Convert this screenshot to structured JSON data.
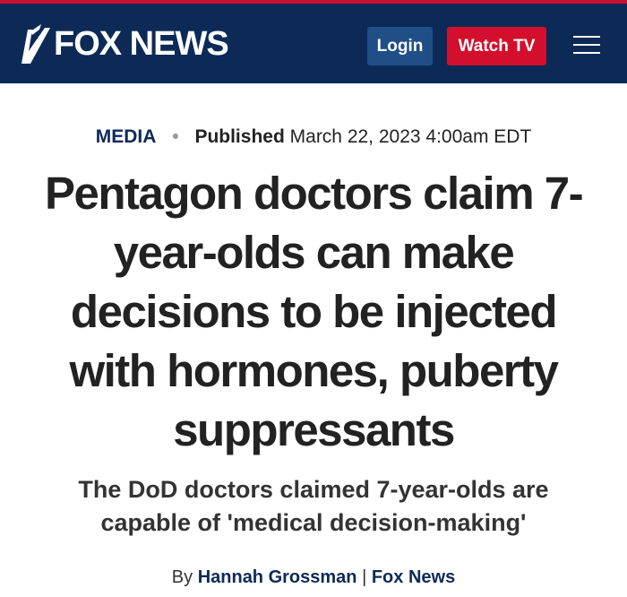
{
  "header": {
    "logo_text": "FOX NEWS",
    "login_label": "Login",
    "watch_label": "Watch TV",
    "menu_icon": "hamburger-menu-icon",
    "colors": {
      "header_bg": "#0d2a57",
      "accent_red": "#d40f2d",
      "login_bg": "#1f4f86"
    }
  },
  "article": {
    "section": "MEDIA",
    "separator": "•",
    "published_label": "Published",
    "published_date": "March 22, 2023 4:00am EDT",
    "headline": "Pentagon doctors claim 7-year-olds can make decisions to be injected with hormones, puberty suppressants",
    "subheadline": "The DoD doctors claimed 7-year-olds are capable of 'medical decision-making'",
    "byline": {
      "prefix": "By",
      "author": "Hannah Grossman",
      "divider": "|",
      "outlet": "Fox News"
    }
  }
}
